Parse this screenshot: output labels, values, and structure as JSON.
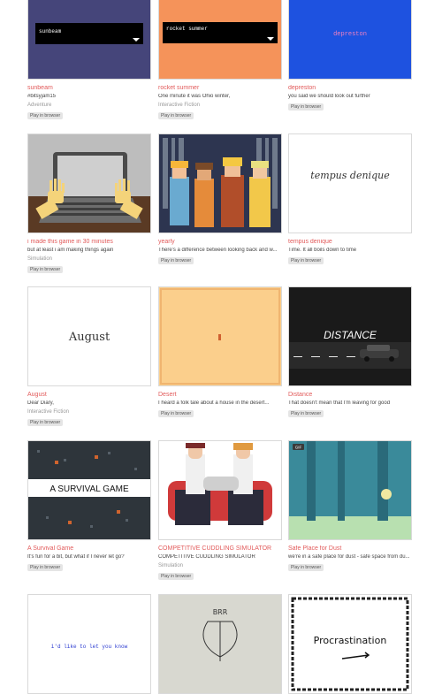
{
  "games": [
    {
      "title": "sunbeam",
      "description": "#bitsyjam15",
      "genre": "Adventure",
      "play": "Play in browser",
      "thumb_text": "sunbeam"
    },
    {
      "title": "rocket summer",
      "description": "One minute it was Ohio winter,",
      "genre": "Interactive Fiction",
      "play": "Play in browser",
      "thumb_text": "rocket summer"
    },
    {
      "title": "depreston",
      "description": "you said we should look out further",
      "genre": "",
      "play": "Play in browser",
      "thumb_text": "depreston"
    },
    {
      "title": "i made this game in 30 minutes",
      "description": "but at least i am making things again",
      "genre": "Simulation",
      "play": "Play in browser"
    },
    {
      "title": "yearly",
      "description": "There's a difference between looking back and w...",
      "genre": "",
      "play": "Play in browser"
    },
    {
      "title": "tempus denique",
      "description": "Time. It all boils down to time",
      "genre": "",
      "play": "Play in browser",
      "thumb_text": "tempus denique"
    },
    {
      "title": "August",
      "description": "Dear Diary,",
      "genre": "Interactive Fiction",
      "play": "Play in browser",
      "thumb_text": "August"
    },
    {
      "title": "Desert",
      "description": "I heard a folk tale about a house in the desert...",
      "genre": "",
      "play": "Play in browser"
    },
    {
      "title": "Distance",
      "description": "That doesn't mean that I'm leaving for good",
      "genre": "",
      "play": "Play in browser",
      "thumb_text": "DISTANCE"
    },
    {
      "title": "A Survival Game",
      "description": "It's fun for a bit, but what if I never let go?",
      "genre": "",
      "play": "Play in browser",
      "thumb_text": "A SURVIVAL GAME"
    },
    {
      "title": "COMPETITIVE CUDDLING SIMULATOR",
      "description": "COMPETITIVE CUDDLING SIMULATOR",
      "genre": "Simulation",
      "play": "Play in browser"
    },
    {
      "title": "Safe Place for Dust",
      "description": "we're in a safe place for dust - safe space from du...",
      "genre": "",
      "play": "Play in browser",
      "badge": "GIF"
    },
    {
      "title": "",
      "description": "",
      "genre": "",
      "play": "",
      "thumb_text": "i'd like to let you know"
    },
    {
      "title": "",
      "description": "",
      "genre": "",
      "play": "",
      "thumb_text": "BRR"
    },
    {
      "title": "",
      "description": "",
      "genre": "",
      "play": "",
      "thumb_text": "Procrastination"
    }
  ],
  "colors": {
    "title": "#e25b5b",
    "play_bg": "#e5e5e5"
  }
}
